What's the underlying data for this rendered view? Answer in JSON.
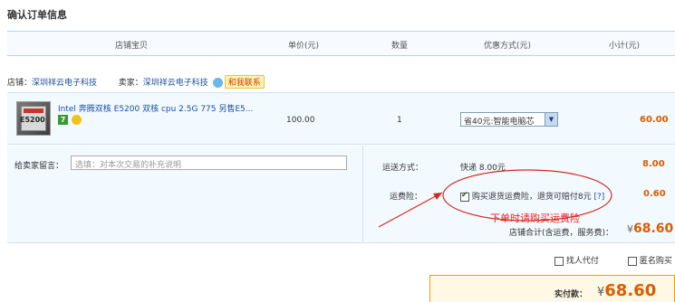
{
  "page_title": "确认订单信息",
  "table_headers": {
    "item": "店铺宝贝",
    "price": "单价(元)",
    "qty": "数量",
    "discount": "优惠方式(元)",
    "subtotal": "小计(元)"
  },
  "shop": {
    "shop_label": "店铺：",
    "shop_name": "深圳祥云电子科技",
    "seller_label": "卖家：",
    "seller_name": "深圳祥云电子科技",
    "contact_label": "和我联系"
  },
  "item": {
    "thumb_text": "E5200",
    "name": "Intel 奔腾双核 E5200 双核 cpu 2.5G 775 另售E5...",
    "badge": "7",
    "price": "100.00",
    "qty": "1",
    "discount_selected": "省40元:智能电脑芯",
    "subtotal": "60.00"
  },
  "message": {
    "label": "给卖家留言：",
    "placeholder": "选填：对本次交易的补充说明"
  },
  "shipping": {
    "label": "运送方式：",
    "value": "快递 8.00元",
    "price": "8.00"
  },
  "insurance": {
    "label": "运费险：",
    "option": "购买退货运费险，退货可赔付8元",
    "help": "[?]",
    "price": "0.60",
    "checked": true
  },
  "annotation": {
    "text": "下单时请购买运费险"
  },
  "shop_total": {
    "label": "店铺合计(含运费，服务费)：",
    "currency": "¥",
    "value": "68.60"
  },
  "options": {
    "proxy_pay": "找人代付",
    "anonymous": "匿名购买"
  },
  "payment": {
    "label": "实付款：",
    "currency": "¥",
    "value": "68.60"
  },
  "colors": {
    "accent_orange": "#d95d00",
    "annotation_red": "#e8231c",
    "link_blue": "#1a4fa0"
  }
}
